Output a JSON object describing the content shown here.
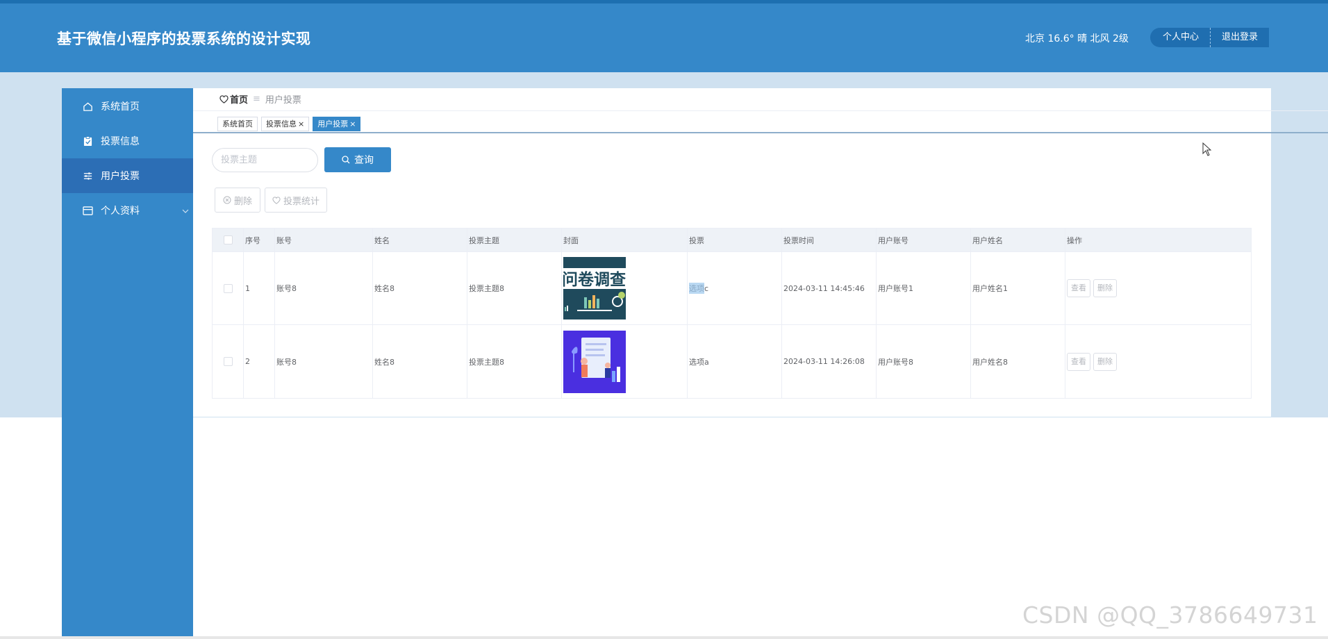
{
  "header": {
    "title": "基于微信小程序的投票系统的设计实现",
    "weather": "北京  16.6°  晴  北风  2级",
    "profile_label": "个人中心",
    "logout_label": "退出登录"
  },
  "sidebar": {
    "items": [
      {
        "label": "系统首页",
        "icon": "home-icon",
        "active": false
      },
      {
        "label": "投票信息",
        "icon": "clipboard-icon",
        "active": false
      },
      {
        "label": "用户投票",
        "icon": "sliders-icon",
        "active": true
      },
      {
        "label": "个人资料",
        "icon": "card-icon",
        "active": false,
        "expandable": true
      }
    ]
  },
  "breadcrumb": {
    "home": "首页",
    "separator": "≡",
    "current": "用户投票"
  },
  "tabs": [
    {
      "label": "系统首页",
      "closable": false,
      "active": false
    },
    {
      "label": "投票信息",
      "closable": true,
      "active": false
    },
    {
      "label": "用户投票",
      "closable": true,
      "active": true
    }
  ],
  "tab_close_glyph": "×",
  "search": {
    "placeholder": "投票主题",
    "value": "",
    "button_label": "查询"
  },
  "actions": {
    "delete_label": "删除",
    "stats_label": "投票统计"
  },
  "table": {
    "columns": [
      "",
      "序号",
      "账号",
      "姓名",
      "投票主题",
      "封面",
      "投票",
      "投票时间",
      "用户账号",
      "用户姓名",
      "操作"
    ],
    "rows": [
      {
        "index": "1",
        "account": "账号8",
        "name": "姓名8",
        "topic": "投票主题8",
        "cover": "survey-cover",
        "vote_highlight": "选项",
        "vote_rest": "c",
        "time": "2024-03-11 14:45:46",
        "user_account": "用户账号1",
        "user_name": "用户姓名1",
        "view_label": "查看",
        "delete_label": "删除"
      },
      {
        "index": "2",
        "account": "账号8",
        "name": "姓名8",
        "topic": "投票主题8",
        "cover": "illustration-cover",
        "vote_highlight": "",
        "vote_rest": "选项a",
        "time": "2024-03-11 14:26:08",
        "user_account": "用户账号8",
        "user_name": "用户姓名8",
        "view_label": "查看",
        "delete_label": "删除"
      }
    ]
  },
  "cover_text": "问卷调查",
  "watermark": "CSDN @QQ_3786649731",
  "colors": {
    "primary": "#3588c9",
    "sidebar_active": "#2c6eb5",
    "background_band": "#cfe1f0"
  }
}
